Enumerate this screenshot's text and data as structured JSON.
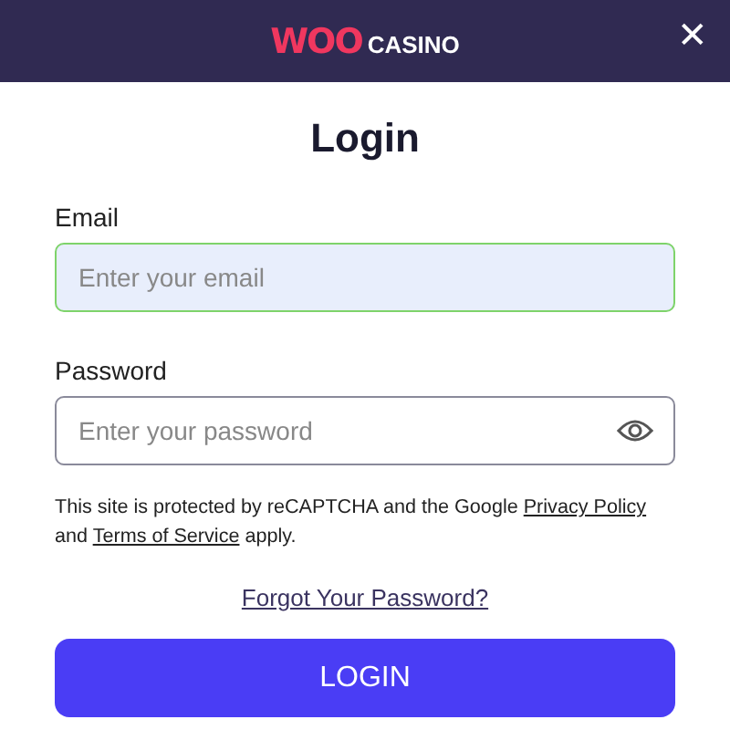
{
  "header": {
    "logo_brand": "WOO",
    "logo_text": "CASINO",
    "close": "✕"
  },
  "title": "Login",
  "fields": [
    {
      "label": "Email",
      "placeholder": "Enter your email",
      "focused": true,
      "kind": "text"
    },
    {
      "label": "Password",
      "placeholder": "Enter your password",
      "focused": false,
      "kind": "password"
    }
  ],
  "notice": [
    {
      "kind": "text",
      "text": "This site is protected by reCAPTCHA and the Google "
    },
    {
      "kind": "link",
      "text": "Privacy Policy"
    },
    {
      "kind": "text",
      "text": " and "
    },
    {
      "kind": "link",
      "text": "Terms of Service"
    },
    {
      "kind": "text",
      "text": " apply."
    }
  ],
  "forgot_link": "Forgot Your Password?",
  "submit": "LOGIN"
}
